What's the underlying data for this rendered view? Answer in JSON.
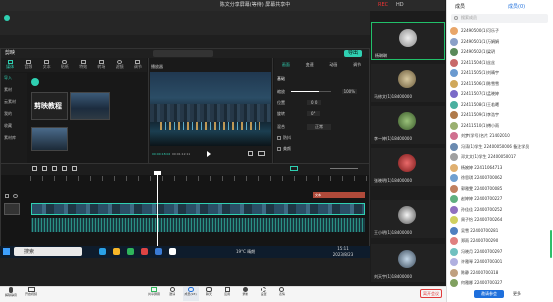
{
  "meeting": {
    "title_left": "陈文分享屏幕(等待)  屏幕共享中",
    "rec_label": "REC",
    "hd_label": "HD",
    "panel_toggle": "成员(0)"
  },
  "editor": {
    "app_name": "剪映",
    "top_tabs": [
      "媒体",
      "音频",
      "文本",
      "贴纸",
      "特效",
      "转场",
      "滤镜",
      "调节"
    ],
    "side_items": [
      "导入",
      "素材",
      "云素材",
      "我的",
      "收藏",
      "素材库"
    ],
    "thumb_caption": "剪映教程",
    "player_label": "播放器",
    "timecode": "00:00:18:02",
    "duration": "00:01:12:11",
    "right_tabs": [
      "画面",
      "变速",
      "动画",
      "调节"
    ],
    "right_rows": [
      {
        "label": "基础",
        "value": ""
      },
      {
        "label": "缩放",
        "value": "100%"
      },
      {
        "label": "位置",
        "value": "0  0"
      },
      {
        "label": "旋转",
        "value": "0°"
      },
      {
        "label": "混合",
        "value": "正常"
      },
      {
        "label": "防抖",
        "value": ""
      },
      {
        "label": "美颜",
        "value": ""
      }
    ],
    "track_text_label": "文本",
    "export_label": "导出"
  },
  "taskbar": {
    "search_placeholder": "搜索",
    "weather": "19°C 晴朗",
    "time": "15:11",
    "date": "2023/8/23"
  },
  "participants_video": [
    {
      "name": "杨琳琳"
    },
    {
      "name": "马修文(1)18400000"
    },
    {
      "name": "李一婷(1)18400000"
    },
    {
      "name": "张晓明(1)18400000"
    },
    {
      "name": "王小明(1)18400000"
    },
    {
      "name": "刘天宇(1)18400000"
    }
  ],
  "member_panel": {
    "title": "成员",
    "search_placeholder": "搜索成员",
    "members": [
      "22490500(1)可乐子",
      "22490501(1)万娟娟",
      "22490502(1)梁玥",
      "22411504(1)丝丝",
      "22411505(1)刘晴宇",
      "22411506(1)陈雪雪",
      "22411507(1)孟晓婷",
      "22411508(1)王若曦",
      "22411509(1)李浩宇",
      "22411510(1)傅小雨",
      "刘梦(学号)名片 21402010",
      "冯涛(1)学生 22400050006 备注学员",
      "邓文文(1)学生 22400050017",
      "杨婉婷 22411064713",
      "徐思琪 22400700062",
      "郭雅雯 22400700085",
      "赵婷婷 22400700227",
      "孙佳佳 22400700252",
      "周子怡 22400700264",
      "吴雪 22400700281",
      "郑雨 22400700290",
      "冯晓月 22400700297",
      "许雅琴 22400700301",
      "陈静 22400700318",
      "何雅娜 22400700327"
    ],
    "btn_invite": "邀请参会",
    "btn_more": "更多"
  },
  "toolbar": {
    "left_items": [
      {
        "label": "解除静音",
        "icon": "mic-icon"
      },
      {
        "label": "开启视频",
        "icon": "camera-icon"
      }
    ],
    "center_items": [
      {
        "label": "共享屏幕",
        "icon": "share-icon"
      },
      {
        "label": "邀请",
        "icon": "invite-icon"
      },
      {
        "label": "成员(93)",
        "icon": "members-icon"
      },
      {
        "label": "聊天",
        "icon": "chat-icon"
      },
      {
        "label": "应用",
        "icon": "apps-icon"
      },
      {
        "label": "录制",
        "icon": "record-icon"
      },
      {
        "label": "设置",
        "icon": "settings-icon"
      },
      {
        "label": "表情",
        "icon": "emoji-icon"
      }
    ],
    "leave_label": "离开会议",
    "end_label": "结束会议"
  },
  "colors": {
    "accent": "#1e6fdc",
    "editor_green": "#2fd0b2",
    "leave_red": "#e23b3b",
    "speaking_green": "#22c06a"
  }
}
